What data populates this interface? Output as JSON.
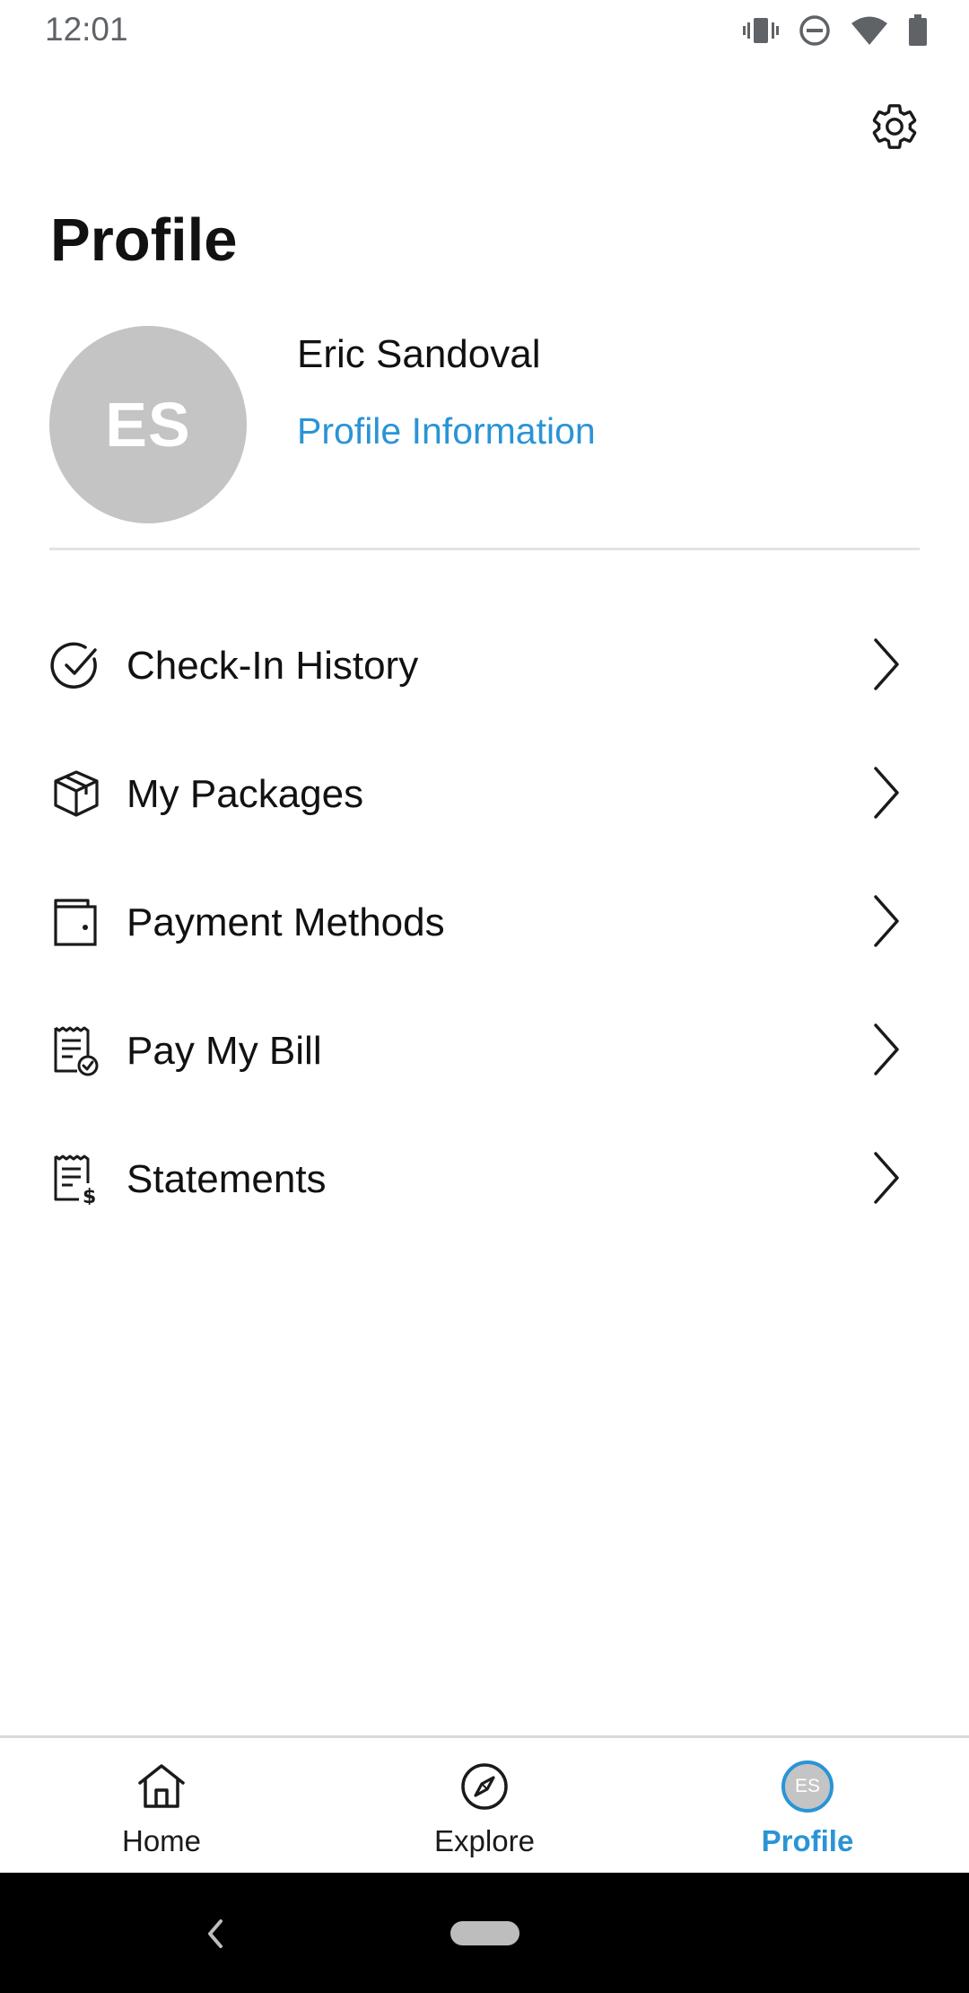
{
  "status_bar": {
    "time": "12:01",
    "icons": [
      "vibrate-icon",
      "do-not-disturb-icon",
      "wifi-icon",
      "battery-icon"
    ]
  },
  "header": {
    "title": "Profile",
    "settings_icon": "gear-icon"
  },
  "user": {
    "initials": "ES",
    "name": "Eric Sandoval",
    "profile_link": "Profile Information"
  },
  "menu": {
    "items": [
      {
        "label": "Check-In History",
        "icon": "check-circle-icon"
      },
      {
        "label": "My Packages",
        "icon": "package-box-icon"
      },
      {
        "label": "Payment Methods",
        "icon": "wallet-icon"
      },
      {
        "label": "Pay My Bill",
        "icon": "bill-check-icon"
      },
      {
        "label": "Statements",
        "icon": "statement-dollar-icon"
      }
    ]
  },
  "bottom_nav": {
    "items": [
      {
        "label": "Home",
        "icon": "home-icon",
        "active": false
      },
      {
        "label": "Explore",
        "icon": "compass-icon",
        "active": false
      },
      {
        "label": "Profile",
        "icon": "avatar",
        "active": true
      }
    ],
    "avatar_initials": "ES"
  },
  "colors": {
    "accent": "#2a94d6",
    "avatar_bg": "#c4c4c4",
    "text": "#111111",
    "divider": "#e3e3e3"
  }
}
